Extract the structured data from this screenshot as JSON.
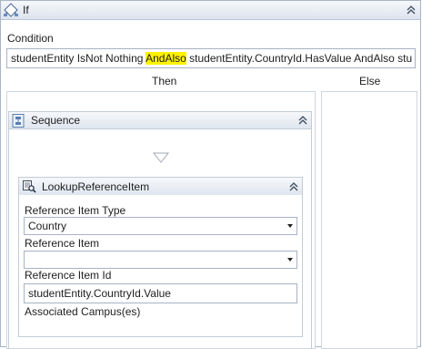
{
  "if_activity": {
    "title": "If",
    "condition_label": "Condition",
    "condition_parts": {
      "before": "studentEntity IsNot Nothing ",
      "highlight": "AndAlso",
      "after": " studentEntity.CountryId.HasValue AndAlso stu"
    },
    "then_label": "Then",
    "else_label": "Else"
  },
  "sequence": {
    "title": "Sequence"
  },
  "lookup": {
    "title": "LookupReferenceItem",
    "reference_item_type_label": "Reference Item Type",
    "reference_item_type_value": "Country",
    "reference_item_label": "Reference Item",
    "reference_item_value": "",
    "reference_item_id_label": "Reference Item Id",
    "reference_item_id_value": "studentEntity.CountryId.Value",
    "associated_campuses_label": "Associated Campus(es)"
  },
  "colors": {
    "highlight": "#fff200",
    "header_border": "#b8c4d4"
  }
}
